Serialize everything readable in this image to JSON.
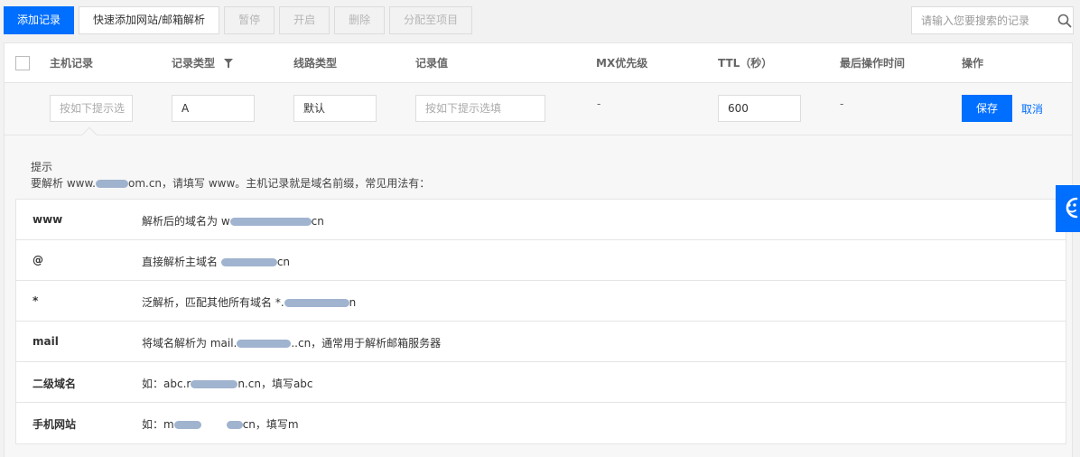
{
  "toolbar": {
    "add_record": "添加记录",
    "quick_add": "快速添加网站/邮箱解析",
    "pause": "暂停",
    "enable": "开启",
    "delete": "删除",
    "assign_project": "分配至项目"
  },
  "search": {
    "placeholder": "请输入您要搜索的记录",
    "icon": "search-icon"
  },
  "table": {
    "headers": {
      "host": "主机记录",
      "type": "记录类型",
      "line": "线路类型",
      "value": "记录值",
      "mx": "MX优先级",
      "ttl": "TTL（秒）",
      "last_op": "最后操作时间",
      "actions": "操作"
    },
    "type_filter_icon": "filter-icon"
  },
  "edit_row": {
    "host_placeholder": "按如下提示选",
    "type_value": "A",
    "line_value": "默认",
    "value_placeholder": "按如下提示选填",
    "mx_value": "-",
    "ttl_value": "600",
    "last_op_value": "-",
    "save": "保存",
    "cancel": "取消"
  },
  "tip": {
    "title": "提示",
    "desc_prefix": "要解析 www.",
    "desc_suffix": "om.cn，请填写 www。主机记录就是域名前缀，常见用法有：",
    "rows": [
      {
        "key": "www",
        "pre": "解析后的域名为 w",
        "post": "cn"
      },
      {
        "key": "@",
        "pre": "直接解析主域名 ",
        "post": "cn"
      },
      {
        "key": "*",
        "pre": "泛解析，匹配其他所有域名 *.",
        "post": "n"
      },
      {
        "key": "mail",
        "pre": "将域名解析为 mail.",
        "post": "..cn，通常用于解析邮箱服务器"
      },
      {
        "key": "二级域名",
        "pre": "如：abc.r",
        "post": "n.cn，填写abc"
      },
      {
        "key": "手机网站",
        "pre": "如：m",
        "post": "cn，填写m"
      }
    ]
  },
  "colors": {
    "primary": "#006eff",
    "border": "#e5e5e5",
    "background": "#f2f2f2"
  }
}
